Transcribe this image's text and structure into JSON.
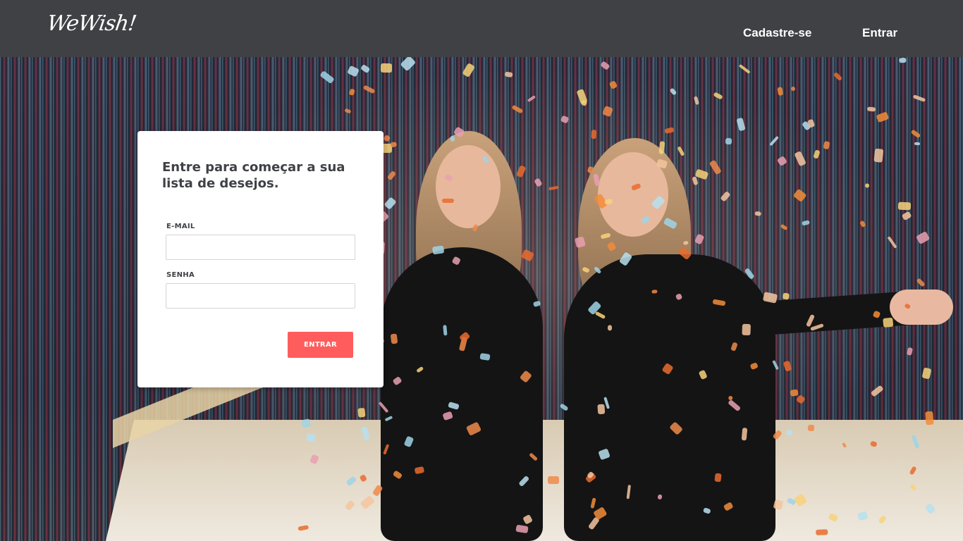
{
  "header": {
    "logo_text": "WeWish!",
    "nav": {
      "signup_label": "Cadastre-se",
      "login_label": "Entrar"
    },
    "background_color": "#3f4145"
  },
  "login_card": {
    "title": "Entre para começar a sua lista de desejos.",
    "email_label": "E-MAIL",
    "email_value": "",
    "password_label": "SENHA",
    "password_value": "",
    "submit_label": "ENTRAR",
    "submit_color": "#ff5d5d"
  },
  "hero": {
    "image_description_icon": "party-photo-image"
  }
}
